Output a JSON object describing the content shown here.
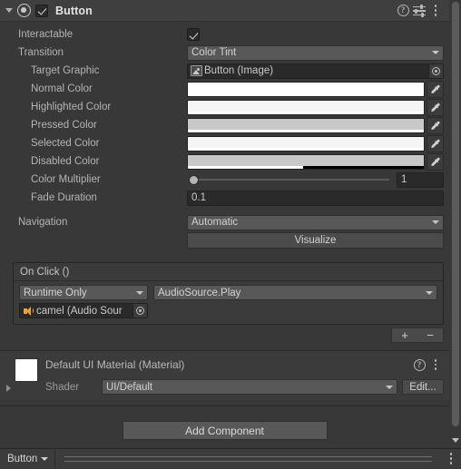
{
  "component": {
    "title": "Button",
    "enabled_checkbox": true,
    "icon": "button-component-icon",
    "header_icons": [
      "help-icon",
      "preset-icon",
      "kebab-menu-icon"
    ]
  },
  "properties": {
    "interactable": {
      "label": "Interactable",
      "value": true
    },
    "transition": {
      "label": "Transition",
      "value": "Color Tint"
    },
    "target_graphic": {
      "label": "Target Graphic",
      "value": "Button (Image)"
    },
    "normal_color": {
      "label": "Normal Color",
      "value": "#FFFFFF",
      "alpha": 100
    },
    "highlighted_color": {
      "label": "Highlighted Color",
      "value": "#F5F5F5",
      "alpha": 100
    },
    "pressed_color": {
      "label": "Pressed Color",
      "value": "#C8C8C8",
      "alpha": 100
    },
    "selected_color": {
      "label": "Selected Color",
      "value": "#F5F5F5",
      "alpha": 100
    },
    "disabled_color": {
      "label": "Disabled Color",
      "value": "#C8C8C8",
      "alpha": 49
    },
    "color_multiplier": {
      "label": "Color Multiplier",
      "value": "1",
      "slider_percent": 0
    },
    "fade_duration": {
      "label": "Fade Duration",
      "value": "0.1"
    },
    "navigation": {
      "label": "Navigation",
      "value": "Automatic"
    },
    "visualize_button": "Visualize"
  },
  "on_click": {
    "header": "On Click ()",
    "entries": [
      {
        "mode": "Runtime Only",
        "function": "AudioSource.Play",
        "object": "camel (Audio Sour",
        "object_icon": "audio-source-icon"
      }
    ],
    "add_label": "+",
    "remove_label": "−"
  },
  "material": {
    "name": "Default UI Material (Material)",
    "shader_label": "Shader",
    "shader_value": "UI/Default",
    "edit_label": "Edit...",
    "swatch_color": "#FFFFFF"
  },
  "add_component": {
    "label": "Add Component"
  },
  "status_bar": {
    "label": "Button"
  },
  "colors": {
    "panel_bg": "#383838",
    "header_bg": "#3F3F3F",
    "input_bg": "#2A2A2A",
    "popup_bg": "#585858",
    "text": "#B4B4B4"
  }
}
